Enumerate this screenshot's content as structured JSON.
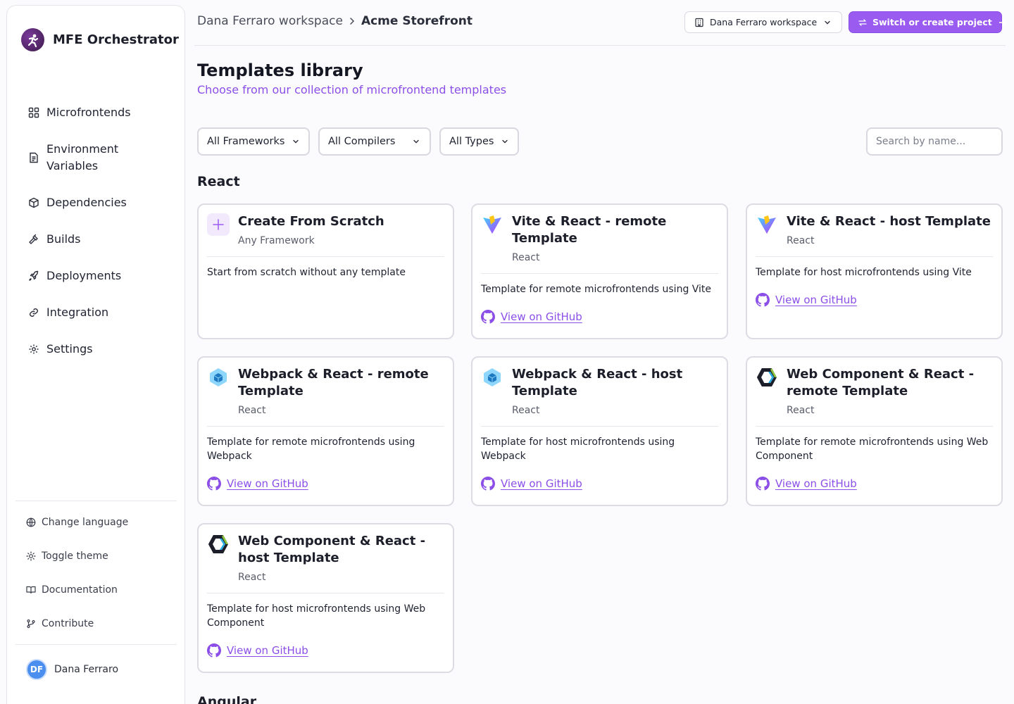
{
  "sidebar": {
    "brand": "MFE Orchestrator",
    "nav": [
      {
        "label": "Microfrontends",
        "icon": "grid-icon"
      },
      {
        "label": "Environment Variables",
        "icon": "file-text-icon"
      },
      {
        "label": "Dependencies",
        "icon": "package-icon"
      },
      {
        "label": "Builds",
        "icon": "hammer-icon"
      },
      {
        "label": "Deployments",
        "icon": "rocket-icon"
      },
      {
        "label": "Integration",
        "icon": "link-icon"
      },
      {
        "label": "Settings",
        "icon": "gear-icon"
      }
    ],
    "secondary": [
      {
        "label": "Change language",
        "icon": "globe-icon"
      },
      {
        "label": "Toggle theme",
        "icon": "sun-icon"
      },
      {
        "label": "Documentation",
        "icon": "book-icon"
      },
      {
        "label": "Contribute",
        "icon": "git-branch-icon"
      }
    ],
    "user": {
      "initials": "DF",
      "name": "Dana Ferraro"
    }
  },
  "header": {
    "breadcrumb_workspace": "Dana Ferraro workspace",
    "breadcrumb_project": "Acme Storefront",
    "workspace_selector": "Dana Ferraro workspace",
    "switch_button": "Switch or create project"
  },
  "page": {
    "title": "Templates library",
    "subtitle": "Choose from our collection of microfrontend templates"
  },
  "filters": {
    "frameworks": "All Frameworks",
    "compilers": "All Compilers",
    "types": "All Types",
    "search_placeholder": "Search by name..."
  },
  "sections": [
    {
      "title": "React",
      "cards": [
        {
          "name": "Create From Scratch",
          "framework": "Any Framework",
          "description": "Start from scratch without any template",
          "icon": "plus-icon",
          "github": ""
        },
        {
          "name": "Vite & React - remote Template",
          "framework": "React",
          "description": "Template for remote microfrontends using Vite",
          "icon": "vite-icon",
          "github": "View on GitHub"
        },
        {
          "name": "Vite & React - host Template",
          "framework": "React",
          "description": "Template for host microfrontends using Vite",
          "icon": "vite-icon",
          "github": "View on GitHub"
        },
        {
          "name": "Webpack & React - remote Template",
          "framework": "React",
          "description": "Template for remote microfrontends using Webpack",
          "icon": "webpack-icon",
          "github": "View on GitHub"
        },
        {
          "name": "Webpack & React - host Template",
          "framework": "React",
          "description": "Template for host microfrontends using Webpack",
          "icon": "webpack-icon",
          "github": "View on GitHub"
        },
        {
          "name": "Web Component & React - remote Template",
          "framework": "React",
          "description": "Template for remote microfrontends using Web Component",
          "icon": "webcomponent-icon",
          "github": "View on GitHub"
        },
        {
          "name": "Web Component & React - host Template",
          "framework": "React",
          "description": "Template for host microfrontends using Web Component",
          "icon": "webcomponent-icon",
          "github": "View on GitHub"
        }
      ]
    },
    {
      "title": "Angular"
    }
  ],
  "colors": {
    "accent": "#8b4fe8",
    "button": "#9a5cf0",
    "border": "#dcdce4"
  }
}
